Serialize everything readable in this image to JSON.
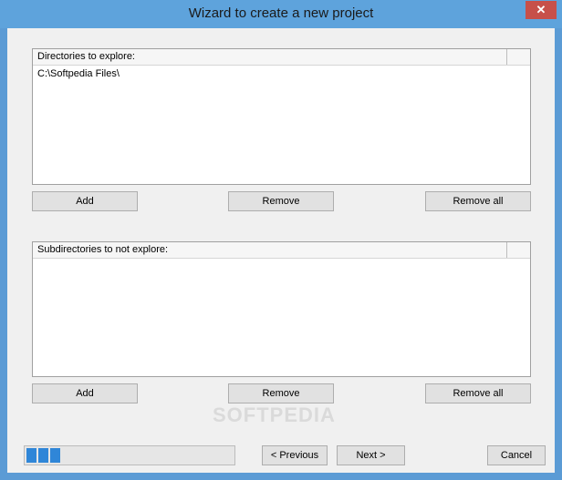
{
  "window": {
    "title": "Wizard to create a new project",
    "close_glyph": "✕"
  },
  "directories": {
    "header": "Directories to explore:",
    "items": [
      "C:\\Softpedia Files\\"
    ],
    "add_label": "Add",
    "remove_label": "Remove",
    "remove_all_label": "Remove all"
  },
  "subdirectories": {
    "header": "Subdirectories to not explore:",
    "items": [],
    "add_label": "Add",
    "remove_label": "Remove",
    "remove_all_label": "Remove all"
  },
  "footer": {
    "progress_segments_filled": 3,
    "previous_label": "< Previous",
    "next_label": "Next >",
    "cancel_label": "Cancel"
  },
  "watermark": "SOFTPEDIA",
  "colors": {
    "titlebar": "#5ea3dc",
    "close_button": "#c7504a",
    "progress_fill": "#2f86d8"
  }
}
